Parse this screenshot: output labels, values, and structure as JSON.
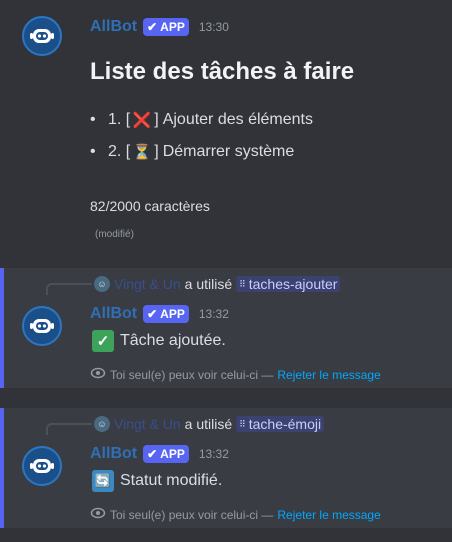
{
  "messages": {
    "first": {
      "author": "AllBot",
      "badge": "APP",
      "time": "13:30",
      "title": "Liste des tâches à faire",
      "tasks": [
        {
          "bullet": "•",
          "number": "1. [",
          "emoji": "❌",
          "close": "]",
          "text": "Ajouter des éléments",
          "emoji_color": "#dd2e44"
        },
        {
          "bullet": "•",
          "number": "2. [",
          "emoji": "⏳",
          "close": "]",
          "text": "Démarrer système",
          "emoji_color": "#f4b43a"
        }
      ],
      "counter": "82/2000 caractères",
      "edited": "(modifié)"
    },
    "second": {
      "reply_user": "Vingt & Un",
      "reply_action": "a utilisé",
      "command": "taches-ajouter",
      "author": "AllBot",
      "badge": "APP",
      "time": "13:32",
      "emoji": "✓",
      "emoji_color": "#3ea35a",
      "text": "Tâche ajoutée.",
      "footer_note": "Toi seul(e) peux voir celui-ci —",
      "dismiss": "Rejeter le message"
    },
    "third": {
      "reply_user": "Vingt & Un",
      "reply_action": "a utilisé",
      "command": "tache-émoji",
      "author": "AllBot",
      "badge": "APP",
      "time": "13:32",
      "emoji": "🔄",
      "emoji_color": "#3b88c3",
      "text": "Statut modifié.",
      "footer_note": "Toi seul(e) peux voir celui-ci —",
      "dismiss": "Rejeter le message"
    }
  },
  "colors": {
    "background": "#313338",
    "ephemeral_bg": "#3a3c44",
    "accent": "#5865f2",
    "author": "#2f6fb3",
    "link": "#00a8fc"
  },
  "icons": {
    "avatar": "robot-headset-icon",
    "badge_check": "check-icon",
    "command": "slash-command-icon",
    "eye": "eye-icon"
  }
}
